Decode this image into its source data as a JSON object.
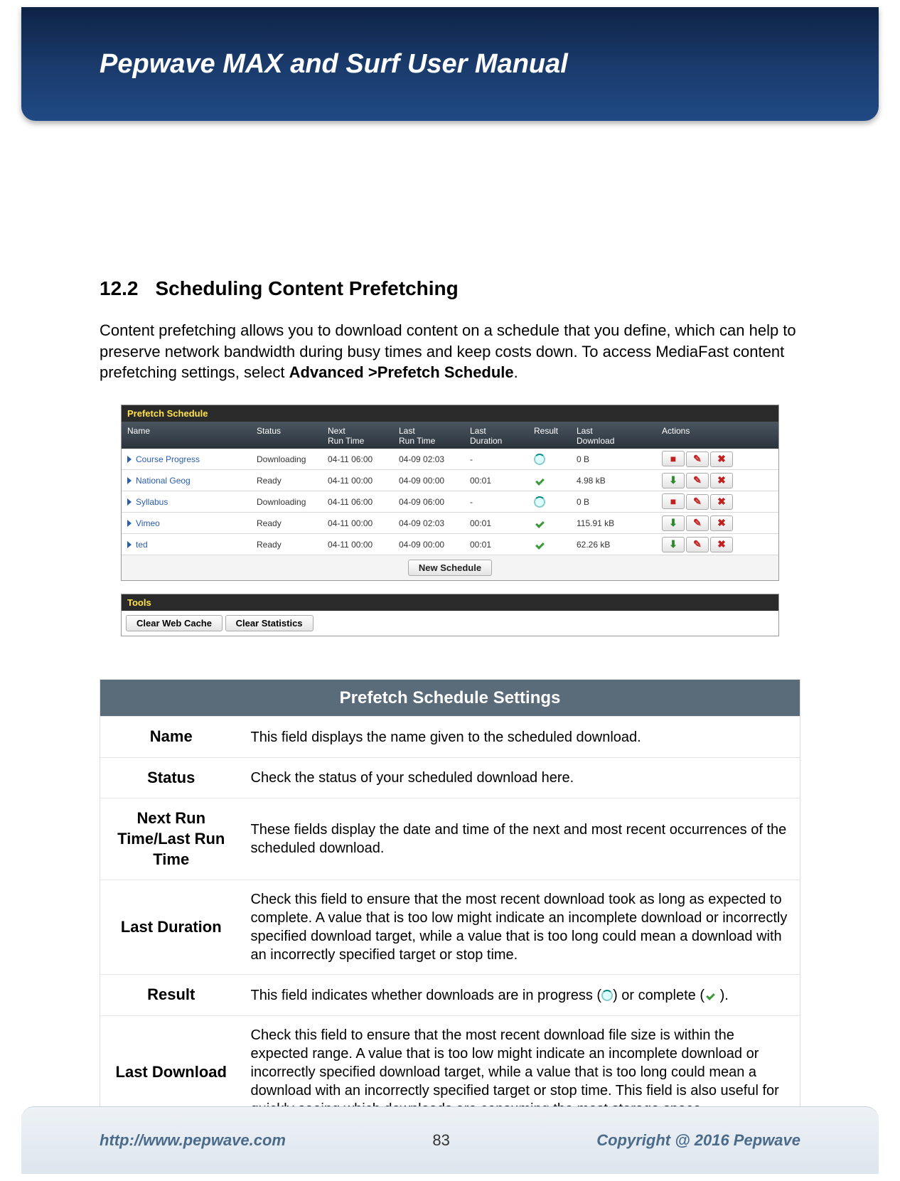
{
  "header": {
    "title": "Pepwave MAX and Surf User Manual"
  },
  "section": {
    "number": "12.2",
    "title": "Scheduling Content Prefetching",
    "intro_pre": "Content prefetching allows you to download content on a schedule that you define, which can help to preserve network bandwidth during busy times and keep costs down. To access MediaFast content prefetching settings, select ",
    "intro_bold": "Advanced >Prefetch Schedule",
    "intro_post": "."
  },
  "prefetch_panel": {
    "title": "Prefetch Schedule",
    "columns": {
      "name": "Name",
      "status": "Status",
      "next": "Next\nRun Time",
      "last": "Last\nRun Time",
      "dur": "Last\nDuration",
      "res": "Result",
      "dl": "Last\nDownload",
      "act": "Actions"
    },
    "rows": [
      {
        "name": "Course Progress",
        "status": "Downloading",
        "next": "04-11 06:00",
        "last": "04-09 02:03",
        "dur": "-",
        "res": "spin",
        "dl": "0 B",
        "primary": "stop"
      },
      {
        "name": "National Geog",
        "status": "Ready",
        "next": "04-11 00:00",
        "last": "04-09 00:00",
        "dur": "00:01",
        "res": "check",
        "dl": "4.98 kB",
        "primary": "dl"
      },
      {
        "name": "Syllabus",
        "status": "Downloading",
        "next": "04-11 06:00",
        "last": "04-09 06:00",
        "dur": "-",
        "res": "spin",
        "dl": "0 B",
        "primary": "stop"
      },
      {
        "name": "Vimeo",
        "status": "Ready",
        "next": "04-11 00:00",
        "last": "04-09 02:03",
        "dur": "00:01",
        "res": "check",
        "dl": "115.91 kB",
        "primary": "dl"
      },
      {
        "name": "ted",
        "status": "Ready",
        "next": "04-11 00:00",
        "last": "04-09 00:00",
        "dur": "00:01",
        "res": "check",
        "dl": "62.26 kB",
        "primary": "dl"
      }
    ],
    "new_schedule": "New Schedule"
  },
  "tools_panel": {
    "title": "Tools",
    "clear_cache": "Clear Web Cache",
    "clear_stats": "Clear Statistics"
  },
  "settings": {
    "header": "Prefetch Schedule Settings",
    "rows": [
      {
        "label": "Name",
        "desc": "This field displays the name given to the scheduled download."
      },
      {
        "label": "Status",
        "desc": "Check the status of your scheduled download here."
      },
      {
        "label": "Next Run Time/Last Run Time",
        "desc": "These fields display the date and time of the next and most recent occurrences of the scheduled download."
      },
      {
        "label": "Last Duration",
        "desc": "Check this field to ensure that the most recent download took as long as expected to complete. A value that is too low might indicate an incomplete download or incorrectly specified download target, while a value that is too long could mean a download with an incorrectly specified target or stop time."
      },
      {
        "label": "Result",
        "desc_pre": "This field indicates whether downloads are in progress (",
        "desc_mid": ") or complete (",
        "desc_post": " )."
      },
      {
        "label": "Last Download",
        "desc": "Check this field to ensure that the most recent download file size is within the expected range. A value that is too low might indicate an incomplete download or incorrectly specified download target, while a value that is too long could mean a download with an incorrectly specified target or stop time. This field is also useful for quickly seeing which downloads are consuming the most storage space."
      }
    ]
  },
  "footer": {
    "url": "http://www.pepwave.com",
    "page": "83",
    "copyright": "Copyright @ 2016 Pepwave"
  }
}
